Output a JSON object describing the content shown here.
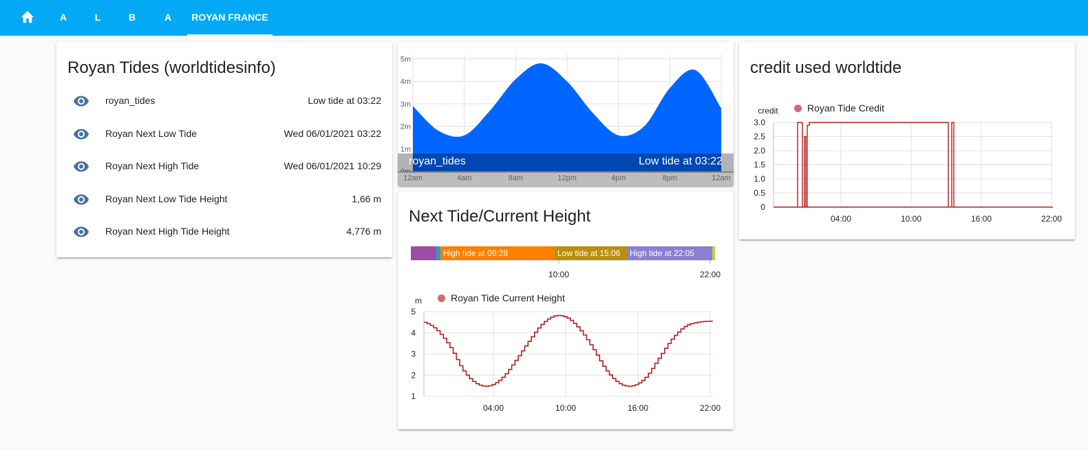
{
  "header": {
    "tabs": [
      {
        "label": "",
        "icon": "home-icon"
      },
      {
        "label": "A"
      },
      {
        "label": "L"
      },
      {
        "label": "B"
      },
      {
        "label": "A"
      },
      {
        "label": "ROYAN FRANCE",
        "active": true
      }
    ]
  },
  "entities_card": {
    "title": "Royan Tides (worldtidesinfo)",
    "rows": [
      {
        "icon": "eye-icon",
        "name": "royan_tides",
        "value": "Low tide at 03:22"
      },
      {
        "icon": "eye-icon",
        "name": "Royan Next Low Tide",
        "value": "Wed 06/01/2021 03:22"
      },
      {
        "icon": "eye-icon",
        "name": "Royan Next High Tide",
        "value": "Wed 06/01/2021 10:29"
      },
      {
        "icon": "eye-icon",
        "name": "Royan Next Low Tide Height",
        "value": "1,66 m"
      },
      {
        "icon": "eye-icon",
        "name": "Royan Next High Tide Height",
        "value": "4,776 m"
      }
    ]
  },
  "tide_graph_card": {
    "entity_name": "royan_tides",
    "state": "Low tide at 03:22",
    "fill_color": "#0066ff"
  },
  "timeline_card": {
    "title": "Next Tide/Current Height",
    "segments": [
      {
        "label": "",
        "color": "#9c4da3"
      },
      {
        "label": "",
        "color": "#26a0c2"
      },
      {
        "label": "High tide at 09:28",
        "color": "#ff7f00"
      },
      {
        "label": "Low tide at 15:06",
        "color": "#b8900b"
      },
      {
        "label": "High tide at 22:05",
        "color": "#8a7fd1"
      },
      {
        "label": "",
        "color": "#b9d23a"
      }
    ],
    "ticks": [
      "10:00",
      "22:00"
    ],
    "legend": "Royan Tide Current Height",
    "series_color": "#b71c1c"
  },
  "credit_card": {
    "title": "credit used worldtide",
    "legend": "Royan Tide Credit",
    "series_color": "#b71c1c"
  },
  "chart_data": [
    {
      "type": "area",
      "name": "royan_tides",
      "x": [
        "12am",
        "2am",
        "4am",
        "6am",
        "8am",
        "10am",
        "12pm",
        "2pm",
        "4pm",
        "6pm",
        "8pm",
        "10pm",
        "12am"
      ],
      "values": [
        2.9,
        1.8,
        1.6,
        2.7,
        4.1,
        4.8,
        4.0,
        2.6,
        1.6,
        2.0,
        3.7,
        4.5,
        2.8
      ],
      "xlabel": "",
      "ylabel": "",
      "x_ticks": [
        "12am",
        "4am",
        "8am",
        "12pm",
        "4pm",
        "8pm",
        "12am"
      ],
      "y_ticks": [
        "0m",
        "1m",
        "2m",
        "3m",
        "4m",
        "5m"
      ],
      "ylim": [
        0,
        5.2
      ],
      "grid": true
    },
    {
      "type": "line",
      "name": "Royan Tide Current Height",
      "x": [
        "00:00",
        "01:00",
        "02:00",
        "03:00",
        "04:00",
        "05:00",
        "06:00",
        "07:00",
        "08:00",
        "09:00",
        "10:00",
        "11:00",
        "12:00",
        "13:00",
        "14:00",
        "15:00",
        "16:00",
        "17:00",
        "18:00",
        "19:00",
        "20:00",
        "21:00",
        "22:00"
      ],
      "values": [
        4.5,
        4.1,
        3.3,
        2.2,
        1.6,
        1.5,
        1.9,
        2.7,
        3.6,
        4.4,
        4.8,
        4.7,
        4.1,
        3.2,
        2.2,
        1.6,
        1.5,
        1.9,
        2.8,
        3.7,
        4.3,
        4.5,
        4.55
      ],
      "xlabel": "",
      "ylabel": "m",
      "x_ticks": [
        "04:00",
        "10:00",
        "16:00",
        "22:00"
      ],
      "y_ticks": [
        "1",
        "2",
        "3",
        "4",
        "5"
      ],
      "ylim": [
        1,
        5
      ],
      "grid": true,
      "legend": "top"
    },
    {
      "type": "line",
      "name": "Royan Tide Credit",
      "x": [
        "22:00",
        "23:30",
        "23:45",
        "00:00",
        "00:20",
        "00:40",
        "01:00",
        "01:20",
        "01:45",
        "11:45",
        "12:05",
        "12:20",
        "12:40",
        "22:00"
      ],
      "values": [
        0,
        0,
        3,
        3,
        0,
        2.5,
        0,
        2.9,
        3,
        0,
        0,
        3,
        0,
        0
      ],
      "xlabel": "",
      "ylabel": "credit",
      "x_ticks": [
        "04:00",
        "10:00",
        "16:00",
        "22:00"
      ],
      "y_ticks": [
        "0",
        "0.5",
        "1.0",
        "1.5",
        "2.0",
        "2.5",
        "3.0"
      ],
      "ylim": [
        0,
        3
      ],
      "grid": true,
      "legend": "top"
    }
  ]
}
